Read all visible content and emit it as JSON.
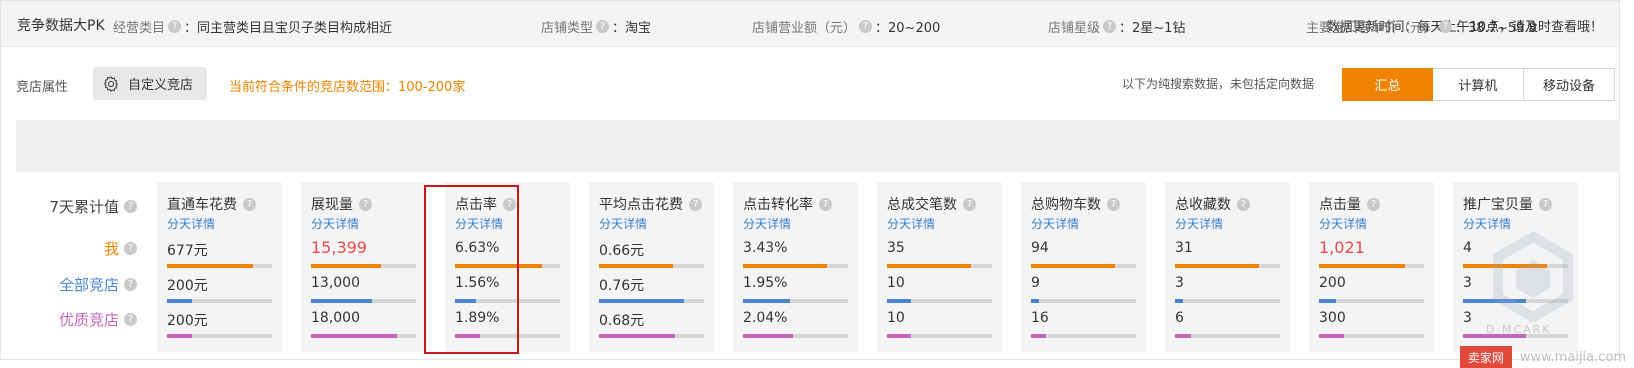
{
  "header": {
    "title": "竞争数据大PK",
    "update_note": "数据更新时间：每天上午10点，请及时查看哦！"
  },
  "toolbar": {
    "attr_label": "竞店属性",
    "custom_button": "自定义竞店",
    "range_note": "当前符合条件的竞店数范围：100-200家",
    "search_note": "以下为纯搜索数据，未包括定向数据",
    "segments": [
      {
        "label": "汇总",
        "active": true
      },
      {
        "label": "计算机",
        "active": false
      },
      {
        "label": "移动设备",
        "active": false
      }
    ]
  },
  "filters": [
    {
      "key": "经营类目",
      "value": "：同主营类目且宝贝子类目构成相近"
    },
    {
      "key": "店铺类型",
      "value": "：淘宝"
    },
    {
      "key": "店铺营业额（元）",
      "value": "：20~200"
    },
    {
      "key": "店铺星级",
      "value": "：2星~1钻"
    },
    {
      "key": "主要宝贝客单价（元）",
      "value": "：38.7~59.8"
    }
  ],
  "row_labels": {
    "header": "7天累计值",
    "me": "我",
    "all": "全部竞店",
    "quality": "优质竞店"
  },
  "colors": {
    "me": "#f08300",
    "all": "#4a86d6",
    "quality": "#c266bd",
    "highlight": "#c8161d",
    "accent": "#f08300"
  },
  "metrics": [
    {
      "name": "直通车花费",
      "detail": "分天详情",
      "me": "677元",
      "all": "200元",
      "quality": "200元",
      "me_pct": 0.82,
      "all_pct": 0.24,
      "quality_pct": 0.24,
      "me_big": false
    },
    {
      "name": "展现量",
      "detail": "分天详情",
      "me": "15,399",
      "all": "13,000",
      "quality": "18,000",
      "me_pct": 0.67,
      "all_pct": 0.58,
      "quality_pct": 0.82,
      "me_big": true
    },
    {
      "name": "点击率",
      "detail": "分天详情",
      "me": "6.63%",
      "all": "1.56%",
      "quality": "1.89%",
      "me_pct": 0.83,
      "all_pct": 0.2,
      "quality_pct": 0.24,
      "me_big": false
    },
    {
      "name": "平均点击花费",
      "detail": "分天详情",
      "me": "0.66元",
      "all": "0.76元",
      "quality": "0.68元",
      "me_pct": 0.7,
      "all_pct": 0.81,
      "quality_pct": 0.72,
      "me_big": false
    },
    {
      "name": "点击转化率",
      "detail": "分天详情",
      "me": "3.43%",
      "all": "1.95%",
      "quality": "2.04%",
      "me_pct": 0.8,
      "all_pct": 0.45,
      "quality_pct": 0.48,
      "me_big": false
    },
    {
      "name": "总成交笔数",
      "detail": "分天详情",
      "me": "35",
      "all": "10",
      "quality": "10",
      "me_pct": 0.8,
      "all_pct": 0.23,
      "quality_pct": 0.23,
      "me_big": false
    },
    {
      "name": "总购物车数",
      "detail": "分天详情",
      "me": "94",
      "all": "9",
      "quality": "16",
      "me_pct": 0.8,
      "all_pct": 0.08,
      "quality_pct": 0.14,
      "me_big": false
    },
    {
      "name": "总收藏数",
      "detail": "分天详情",
      "me": "31",
      "all": "3",
      "quality": "6",
      "me_pct": 0.8,
      "all_pct": 0.08,
      "quality_pct": 0.15,
      "me_big": false
    },
    {
      "name": "点击量",
      "detail": "分天详情",
      "me": "1,021",
      "all": "200",
      "quality": "300",
      "me_pct": 0.82,
      "all_pct": 0.16,
      "quality_pct": 0.24,
      "me_big": true
    },
    {
      "name": "推广宝贝量",
      "detail": "分天详情",
      "me": "4",
      "all": "3",
      "quality": "3",
      "me_pct": 0.8,
      "all_pct": 0.6,
      "quality_pct": 0.6,
      "me_big": false
    }
  ],
  "watermark": {
    "brand": "D·MCARK",
    "site_badge": "卖家网",
    "site": "www.maijia.com"
  }
}
